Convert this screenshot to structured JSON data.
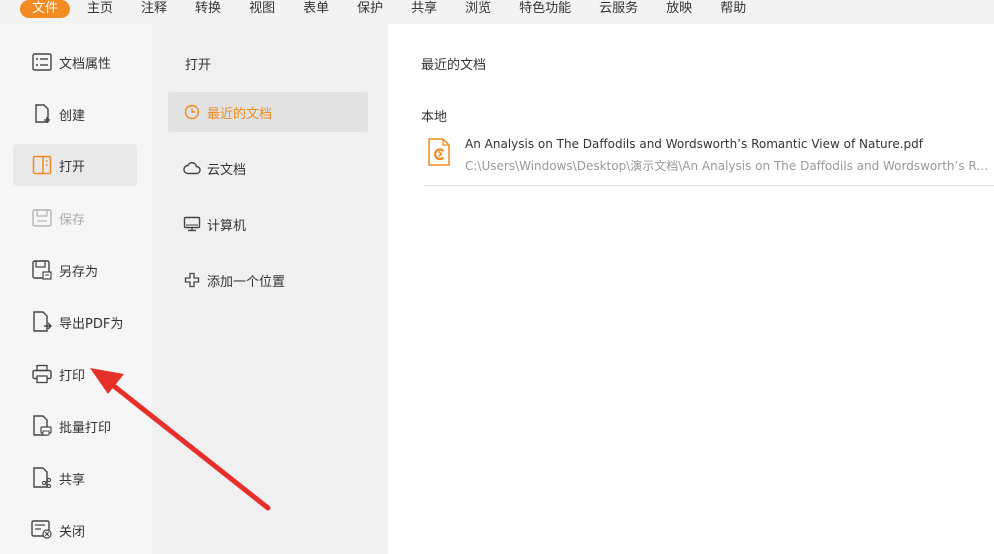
{
  "menu": {
    "items": [
      "文件",
      "主页",
      "注释",
      "转换",
      "视图",
      "表单",
      "保护",
      "共享",
      "浏览",
      "特色功能",
      "云服务",
      "放映",
      "帮助"
    ],
    "active_index": 0
  },
  "left_menu": {
    "items": [
      {
        "label": "文档属性",
        "icon": "document-properties-icon"
      },
      {
        "label": "创建",
        "icon": "create-icon"
      },
      {
        "label": "打开",
        "icon": "open-icon"
      },
      {
        "label": "保存",
        "icon": "save-icon"
      },
      {
        "label": "另存为",
        "icon": "save-as-icon"
      },
      {
        "label": "导出PDF为",
        "icon": "export-pdf-icon"
      },
      {
        "label": "打印",
        "icon": "print-icon"
      },
      {
        "label": "批量打印",
        "icon": "batch-print-icon"
      },
      {
        "label": "共享",
        "icon": "share-icon"
      },
      {
        "label": "关闭",
        "icon": "close-doc-icon"
      }
    ],
    "active_index": 2,
    "disabled_index": 3
  },
  "middle": {
    "title": "打开",
    "items": [
      {
        "label": "最近的文档",
        "icon": "clock-icon"
      },
      {
        "label": "云文档",
        "icon": "cloud-icon"
      },
      {
        "label": "计算机",
        "icon": "computer-icon"
      },
      {
        "label": "添加一个位置",
        "icon": "plus-icon"
      }
    ],
    "active_index": 0
  },
  "content": {
    "title": "最近的文档",
    "section": "本地",
    "files": [
      {
        "name": "An Analysis on The Daffodils and Wordsworth’s Romantic View of Nature.pdf",
        "path": "C:\\Users\\Windows\\Desktop\\演示文档\\An Analysis on The Daffodils and Wordsworth’s Romantic View of Nature.pdf"
      }
    ]
  },
  "colors": {
    "accent": "#f28b22",
    "arrow": "#e8302a"
  }
}
